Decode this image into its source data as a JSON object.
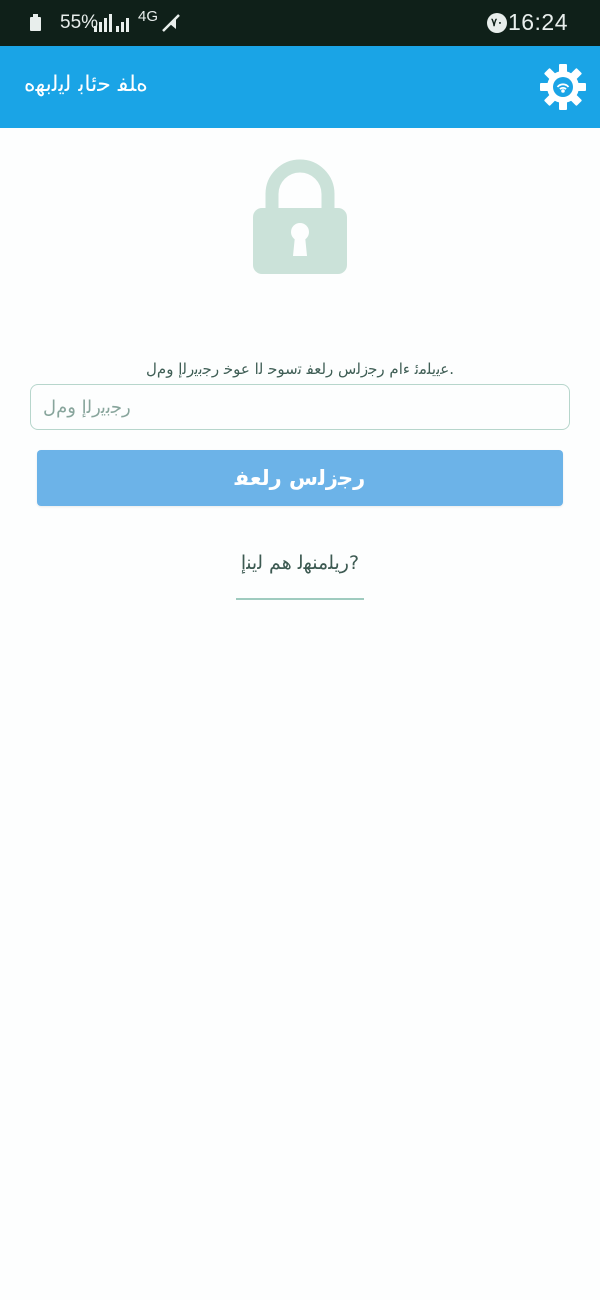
{
  "status_bar": {
    "time": "16:24",
    "badge": "۷۰",
    "battery_percent": "55%",
    "network_type": "4G"
  },
  "app_bar": {
    "title": "ﻩﻠﻔ ﺣﺋﺎﺑ ﻟﻳﻟﺑﻬﻩ",
    "settings_icon": "gear-icon"
  },
  "lock": {
    "icon": "padlock-icon",
    "color": "#cbe2d9"
  },
  "form": {
    "instruction": ".ﻋﻳﻳﻠﻣﺋ ﺀﺍﻡ ﺭﺟﺯﻟﺱ ﺭﻟﻌﻔ ﺗﺳﻮﺣ ﻟﺍ ﻋﻮﺧ ﺭﺟﺑﻳﺭﻟﺇ ﻭﻡﻝ",
    "pin_placeholder": "ﺭﺟﺑﻳﺭﻟﺇ ﻭﻡﻝ",
    "pin_value": "",
    "confirm_label": "ﺭﺟﺯﻟﺱ ﺭﻟﻌﻔ",
    "forgot_label": "?ﺭﻳﻠﻣﻨﻬﻟ ﻫﻢ ﻟﻳﻨﺇ"
  },
  "colors": {
    "status_bar_bg": "#0f2019",
    "app_bar_bg": "#1aa4e6",
    "button_bg": "#6cb3e8",
    "input_border": "#b7d6cc",
    "link_underline": "#9fcbbf"
  }
}
